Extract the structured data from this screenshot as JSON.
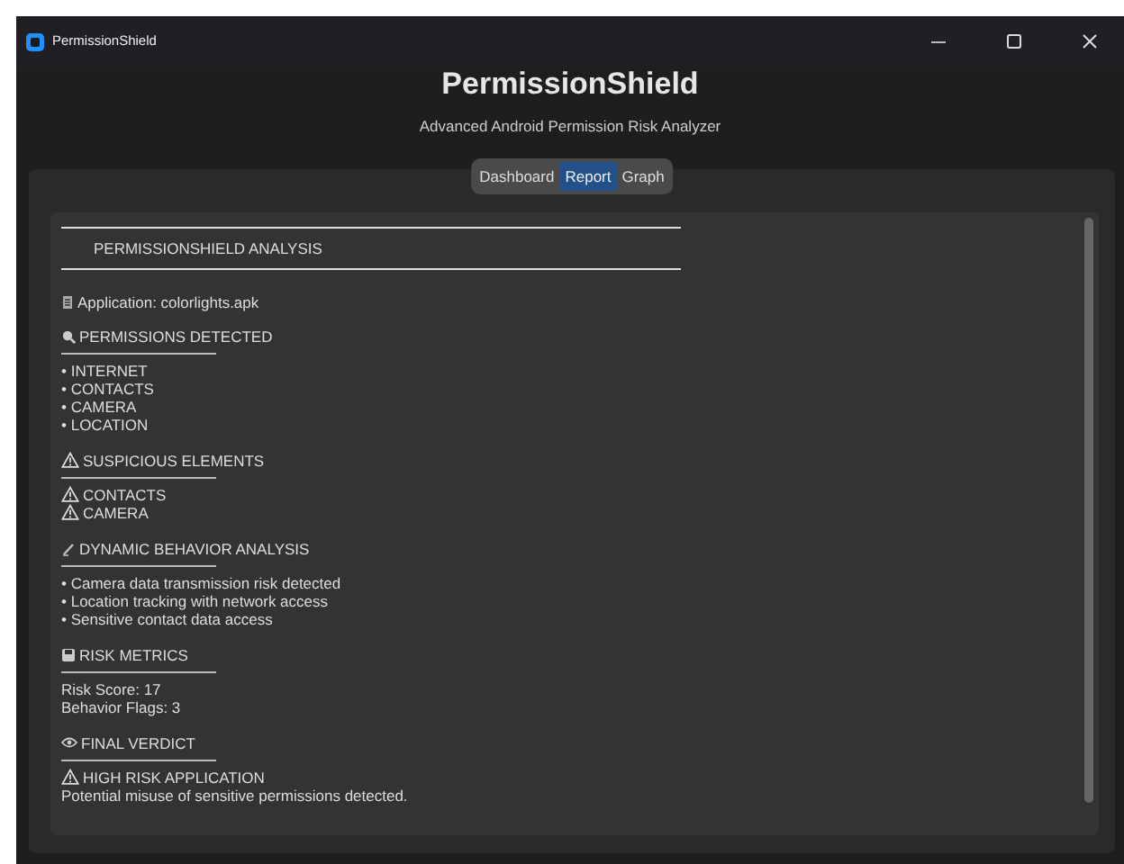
{
  "window": {
    "title": "PermissionShield"
  },
  "header": {
    "title": "PermissionShield",
    "subtitle": "Advanced Android Permission Risk Analyzer"
  },
  "tabs": [
    {
      "label": "Dashboard",
      "selected": false
    },
    {
      "label": "Report",
      "selected": true
    },
    {
      "label": "Graph",
      "selected": false
    }
  ],
  "report": {
    "banner": "PERMISSIONSHIELD ANALYSIS",
    "application": {
      "kind": "document",
      "text": "Application: colorlights.apk"
    },
    "sections": [
      {
        "kind": "search",
        "heading": "PERMISSIONS DETECTED",
        "lines": [
          {
            "kind": "plain",
            "text": "• INTERNET"
          },
          {
            "kind": "plain",
            "text": "• CONTACTS"
          },
          {
            "kind": "plain",
            "text": "• CAMERA"
          },
          {
            "kind": "plain",
            "text": "• LOCATION"
          }
        ]
      },
      {
        "kind": "warning",
        "heading": "SUSPICIOUS ELEMENTS",
        "lines": [
          {
            "kind": "warning",
            "text": "CONTACTS"
          },
          {
            "kind": "warning",
            "text": "CAMERA"
          }
        ]
      },
      {
        "kind": "dynamic",
        "heading": "DYNAMIC BEHAVIOR ANALYSIS",
        "lines": [
          {
            "kind": "plain",
            "text": "• Camera data transmission risk detected"
          },
          {
            "kind": "plain",
            "text": "• Location tracking with network access"
          },
          {
            "kind": "plain",
            "text": "• Sensitive contact data access"
          }
        ]
      },
      {
        "kind": "metrics",
        "heading": "RISK METRICS",
        "lines": [
          {
            "kind": "plain",
            "text": "Risk Score: 17"
          },
          {
            "kind": "plain",
            "text": "Behavior Flags: 3"
          }
        ]
      },
      {
        "kind": "verdict",
        "heading": "FINAL VERDICT",
        "lines": [
          {
            "kind": "warning",
            "text": "HIGH RISK APPLICATION"
          },
          {
            "kind": "plain",
            "text": "Potential misuse of sensitive permissions detected."
          }
        ]
      }
    ]
  }
}
